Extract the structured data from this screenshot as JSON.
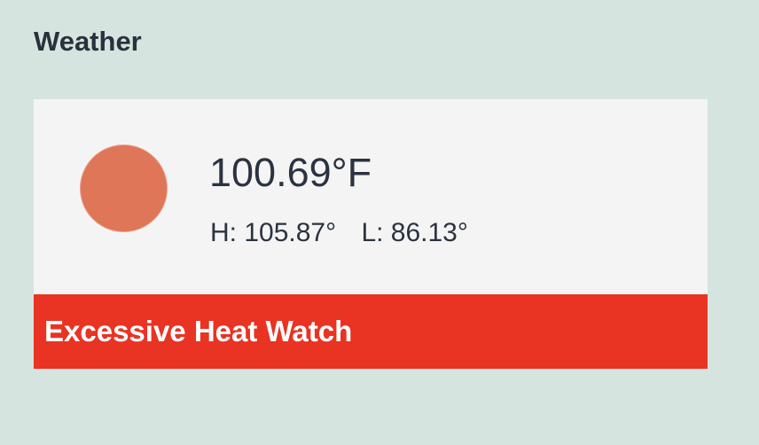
{
  "widget": {
    "title": "Weather"
  },
  "current": {
    "icon": "sun-icon",
    "icon_color": "#df7657",
    "temperature": "100.69°F",
    "high": "H: 105.87°",
    "low": "L: 86.13°"
  },
  "alert": {
    "text": "Excessive Heat Watch",
    "color": "#e93323"
  }
}
